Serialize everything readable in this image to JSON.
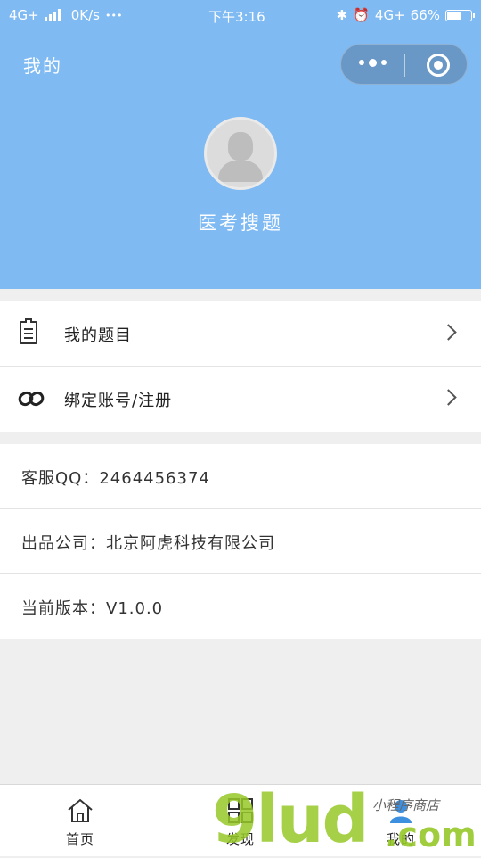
{
  "status_bar": {
    "network": "4G+",
    "speed": "0K/s",
    "dots": "•••",
    "time": "下午3:16",
    "network_right": "4G+",
    "battery_percent": "66%",
    "battery_level": 0.66
  },
  "nav": {
    "title": "我的"
  },
  "profile": {
    "name": "医考搜题"
  },
  "menu": {
    "items": [
      {
        "label": "我的题目",
        "icon": "clipboard-icon"
      },
      {
        "label": "绑定账号/注册",
        "icon": "link-icon"
      }
    ]
  },
  "info": {
    "service_qq": "客服QQ：2464456374",
    "company": "出品公司：北京阿虎科技有限公司",
    "version": "当前版本：V1.0.0"
  },
  "tabbar": {
    "tabs": [
      {
        "label": "首页",
        "icon": "home-icon"
      },
      {
        "label": "发现",
        "icon": "grid-icon"
      },
      {
        "label": "我的",
        "icon": "user-icon"
      }
    ]
  },
  "watermark": {
    "main": "9lud",
    "sub": "小程序商店",
    "tld": ".com"
  },
  "colors": {
    "header_bg": "#7fbaf2",
    "page_bg": "#efefef",
    "watermark_green": "#96c828"
  }
}
